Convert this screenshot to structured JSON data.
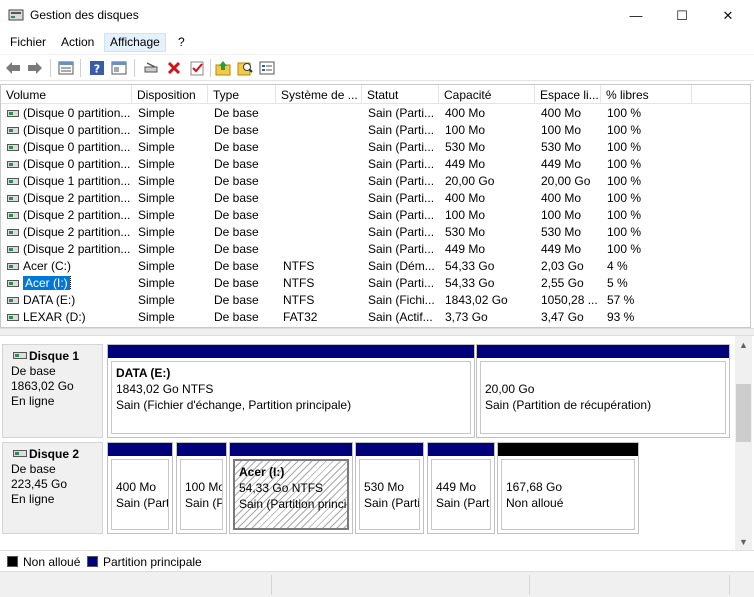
{
  "window": {
    "title": "Gestion des disques",
    "min_glyph": "—",
    "max_glyph": "☐",
    "close_glyph": "✕"
  },
  "menu": {
    "items": [
      "Fichier",
      "Action",
      "Affichage",
      "?"
    ],
    "active": "Affichage"
  },
  "toolbar": {
    "icons": [
      "back-arrow-icon",
      "forward-arrow-icon",
      "disk-list-icon",
      "help-icon",
      "properties-panel-icon",
      "connect-drive-icon",
      "delete-icon",
      "checkmark-icon",
      "up-folder-icon",
      "search-properties-icon",
      "details-icon"
    ]
  },
  "volume_list": {
    "columns": [
      "Volume",
      "Disposition",
      "Type",
      "Système de ...",
      "Statut",
      "Capacité",
      "Espace li...",
      "% libres"
    ],
    "rows": [
      {
        "volume": "(Disque 0 partition...",
        "disposition": "Simple",
        "type": "De base",
        "fs": "",
        "statut": "Sain (Parti...",
        "capacite": "400 Mo",
        "espace": "400 Mo",
        "libres": "100 %"
      },
      {
        "volume": "(Disque 0 partition...",
        "disposition": "Simple",
        "type": "De base",
        "fs": "",
        "statut": "Sain (Parti...",
        "capacite": "100 Mo",
        "espace": "100 Mo",
        "libres": "100 %"
      },
      {
        "volume": "(Disque 0 partition...",
        "disposition": "Simple",
        "type": "De base",
        "fs": "",
        "statut": "Sain (Parti...",
        "capacite": "530 Mo",
        "espace": "530 Mo",
        "libres": "100 %"
      },
      {
        "volume": "(Disque 0 partition...",
        "disposition": "Simple",
        "type": "De base",
        "fs": "",
        "statut": "Sain (Parti...",
        "capacite": "449 Mo",
        "espace": "449 Mo",
        "libres": "100 %"
      },
      {
        "volume": "(Disque 1 partition...",
        "disposition": "Simple",
        "type": "De base",
        "fs": "",
        "statut": "Sain (Parti...",
        "capacite": "20,00 Go",
        "espace": "20,00 Go",
        "libres": "100 %"
      },
      {
        "volume": "(Disque 2 partition...",
        "disposition": "Simple",
        "type": "De base",
        "fs": "",
        "statut": "Sain (Parti...",
        "capacite": "400 Mo",
        "espace": "400 Mo",
        "libres": "100 %"
      },
      {
        "volume": "(Disque 2 partition...",
        "disposition": "Simple",
        "type": "De base",
        "fs": "",
        "statut": "Sain (Parti...",
        "capacite": "100 Mo",
        "espace": "100 Mo",
        "libres": "100 %"
      },
      {
        "volume": "(Disque 2 partition...",
        "disposition": "Simple",
        "type": "De base",
        "fs": "",
        "statut": "Sain (Parti...",
        "capacite": "530 Mo",
        "espace": "530 Mo",
        "libres": "100 %"
      },
      {
        "volume": "(Disque 2 partition...",
        "disposition": "Simple",
        "type": "De base",
        "fs": "",
        "statut": "Sain (Parti...",
        "capacite": "449 Mo",
        "espace": "449 Mo",
        "libres": "100 %"
      },
      {
        "volume": "Acer (C:)",
        "disposition": "Simple",
        "type": "De base",
        "fs": "NTFS",
        "statut": "Sain (Dém...",
        "capacite": "54,33 Go",
        "espace": "2,03 Go",
        "libres": "4 %"
      },
      {
        "volume": "Acer (I:)",
        "disposition": "Simple",
        "type": "De base",
        "fs": "NTFS",
        "statut": "Sain (Parti...",
        "capacite": "54,33 Go",
        "espace": "2,55 Go",
        "libres": "5 %",
        "selected": true
      },
      {
        "volume": "DATA (E:)",
        "disposition": "Simple",
        "type": "De base",
        "fs": "NTFS",
        "statut": "Sain (Fichi...",
        "capacite": "1843,02 Go",
        "espace": "1050,28 ...",
        "libres": "57 %"
      },
      {
        "volume": "LEXAR (D:)",
        "disposition": "Simple",
        "type": "De base",
        "fs": "FAT32",
        "statut": "Sain (Actif...",
        "capacite": "3,73 Go",
        "espace": "3,47 Go",
        "libres": "93 %"
      }
    ]
  },
  "disks": [
    {
      "name": "Disque 1",
      "kind": "De base",
      "size": "1863,02 Go",
      "state": "En ligne",
      "partitions": [
        {
          "title": "DATA  (E:)",
          "line1": "1843,02 Go NTFS",
          "line2": "Sain (Fichier d'échange, Partition principale)",
          "bar": "primary",
          "hatched": false
        },
        {
          "title": "",
          "line1": "20,00 Go",
          "line2": "Sain (Partition de récupération)",
          "bar": "primary",
          "hatched": false
        }
      ]
    },
    {
      "name": "Disque 2",
      "kind": "De base",
      "size": "223,45 Go",
      "state": "En ligne",
      "partitions": [
        {
          "title": "",
          "line1": "400 Mo",
          "line2": "Sain (Parti",
          "bar": "primary",
          "hatched": false
        },
        {
          "title": "",
          "line1": "100 Mo",
          "line2": "Sain (P",
          "bar": "primary",
          "hatched": false
        },
        {
          "title": "Acer  (I:)",
          "line1": "54,33 Go NTFS",
          "line2": "Sain (Partition princip",
          "bar": "primary",
          "hatched": true
        },
        {
          "title": "",
          "line1": "530 Mo",
          "line2": "Sain (Partit",
          "bar": "primary",
          "hatched": false
        },
        {
          "title": "",
          "line1": "449 Mo",
          "line2": "Sain (Parti",
          "bar": "primary",
          "hatched": false
        },
        {
          "title": "",
          "line1": "167,68 Go",
          "line2": "Non alloué",
          "bar": "unallocated",
          "hatched": false
        }
      ]
    }
  ],
  "legend": [
    {
      "label": "Non alloué",
      "color": "#000000"
    },
    {
      "label": "Partition principale",
      "color": "#00007b"
    }
  ]
}
